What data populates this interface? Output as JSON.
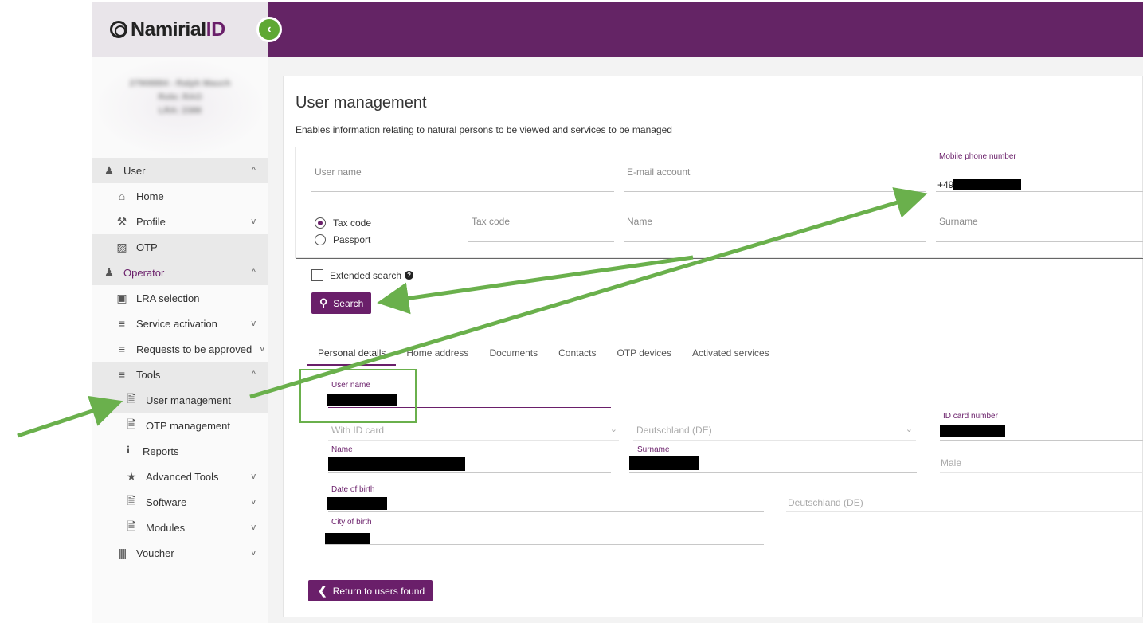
{
  "brand": {
    "logo_text": "Namirial",
    "logo_id": "ID"
  },
  "profile": {
    "line1": "27908884 - Ralph Mauch",
    "line2": "Role: RAO",
    "line3": "LRA: 2388"
  },
  "sidebar": {
    "items": [
      {
        "label": "User",
        "chevron": "^"
      },
      {
        "label": "Home"
      },
      {
        "label": "Profile",
        "chevron": "v"
      },
      {
        "label": "OTP"
      },
      {
        "label": "Operator",
        "chevron": "^"
      },
      {
        "label": "LRA selection"
      },
      {
        "label": "Service activation",
        "chevron": "v"
      },
      {
        "label": "Requests to be approved",
        "chevron": "v"
      },
      {
        "label": "Tools",
        "chevron": "^"
      },
      {
        "label": "User management"
      },
      {
        "label": "OTP management"
      },
      {
        "label": "Reports"
      },
      {
        "label": "Advanced Tools",
        "chevron": "v"
      },
      {
        "label": "Software",
        "chevron": "v"
      },
      {
        "label": "Modules",
        "chevron": "v"
      },
      {
        "label": "Voucher",
        "chevron": "v"
      }
    ]
  },
  "page": {
    "title": "User management",
    "subtitle": "Enables information relating to natural persons to be viewed and services to be managed"
  },
  "search": {
    "user_name_placeholder": "User name",
    "email_placeholder": "E-mail account",
    "mobile_label": "Mobile phone number",
    "mobile_value": "+49",
    "radio_tax_code": "Tax code",
    "radio_passport": "Passport",
    "tax_code_placeholder": "Tax code",
    "name_placeholder": "Name",
    "surname_placeholder": "Surname",
    "extended_search": "Extended search",
    "search_button": "Search"
  },
  "tabs": [
    "Personal details",
    "Home address",
    "Documents",
    "Contacts",
    "OTP devices",
    "Activated services"
  ],
  "details": {
    "user_name_label": "User name",
    "with_id_card": "With ID card",
    "country_1": "Deutschland (DE)",
    "id_card_label": "ID card number",
    "name_label": "Name",
    "surname_label": "Surname",
    "gender": "Male",
    "dob_label": "Date of birth",
    "country_2": "Deutschland (DE)",
    "city_label": "City of birth"
  },
  "return_button": "Return to users found",
  "colors": {
    "brand_purple": "#642465",
    "accent_green": "#6ab04c"
  }
}
